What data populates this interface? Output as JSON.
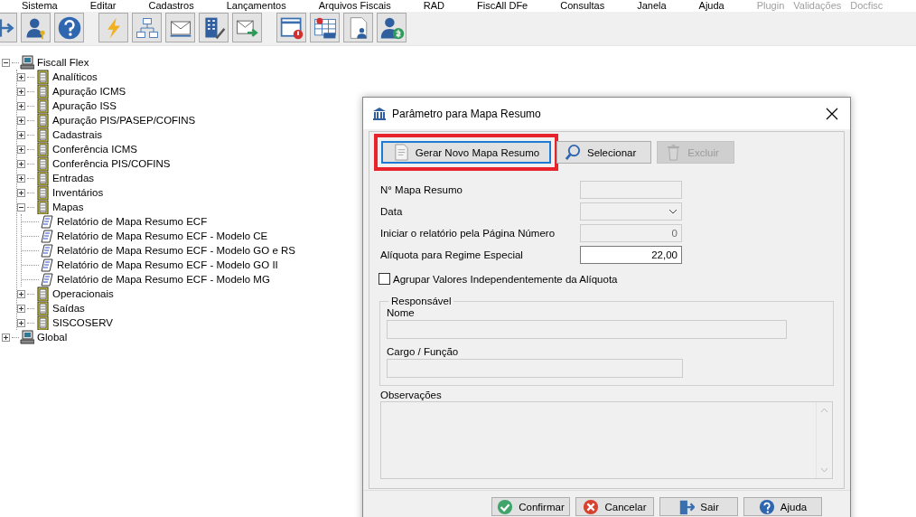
{
  "menu": [
    {
      "label": "Sistema",
      "disabled": false
    },
    {
      "label": "Editar",
      "disabled": false
    },
    {
      "label": "Cadastros",
      "disabled": false
    },
    {
      "label": "Lançamentos",
      "disabled": false
    },
    {
      "label": "Arquivos Fiscais",
      "disabled": false
    },
    {
      "label": "RAD",
      "disabled": false
    },
    {
      "label": "FiscAll DFe",
      "disabled": false
    },
    {
      "label": "Consultas",
      "disabled": false
    },
    {
      "label": "Janela",
      "disabled": false
    },
    {
      "label": "Ajuda",
      "disabled": false
    },
    {
      "label": "Plugin",
      "disabled": true
    },
    {
      "label": "Validações",
      "disabled": true
    },
    {
      "label": "Docfisc",
      "disabled": true
    }
  ],
  "tree": [
    {
      "label": "Fiscall Flex",
      "kind": "root",
      "expanded": true,
      "children": [
        {
          "label": "Analíticos",
          "kind": "folder",
          "expanded": false
        },
        {
          "label": "Apuração ICMS",
          "kind": "folder",
          "expanded": false
        },
        {
          "label": "Apuração ISS",
          "kind": "folder",
          "expanded": false
        },
        {
          "label": "Apuração PIS/PASEP/COFINS",
          "kind": "folder",
          "expanded": false
        },
        {
          "label": "Cadastrais",
          "kind": "folder",
          "expanded": false
        },
        {
          "label": "Conferência ICMS",
          "kind": "folder",
          "expanded": false
        },
        {
          "label": "Conferência PIS/COFINS",
          "kind": "folder",
          "expanded": false
        },
        {
          "label": "Entradas",
          "kind": "folder",
          "expanded": false
        },
        {
          "label": "Inventários",
          "kind": "folder",
          "expanded": false
        },
        {
          "label": "Mapas",
          "kind": "folder",
          "expanded": true,
          "children": [
            {
              "label": "Relatório de Mapa Resumo ECF",
              "kind": "report"
            },
            {
              "label": "Relatório de Mapa Resumo ECF - Modelo CE",
              "kind": "report"
            },
            {
              "label": "Relatório de Mapa Resumo ECF - Modelo GO e RS",
              "kind": "report"
            },
            {
              "label": "Relatório de Mapa Resumo ECF - Modelo GO II",
              "kind": "report"
            },
            {
              "label": "Relatório de Mapa Resumo ECF - Modelo MG",
              "kind": "report"
            }
          ]
        },
        {
          "label": "Operacionais",
          "kind": "folder",
          "expanded": false
        },
        {
          "label": "Saídas",
          "kind": "folder",
          "expanded": false
        },
        {
          "label": "SISCOSERV",
          "kind": "folder",
          "expanded": false
        }
      ]
    },
    {
      "label": "Global",
      "kind": "root",
      "expanded": false
    }
  ],
  "dialog": {
    "title": "Parâmetro para Mapa Resumo",
    "actions": [
      {
        "label": "Gerar Novo Mapa Resumo",
        "disabled": false,
        "highlighted": true
      },
      {
        "label": "Selecionar",
        "disabled": false,
        "highlighted": false
      },
      {
        "label": "Excluir",
        "disabled": true,
        "highlighted": false
      }
    ],
    "fields": [
      {
        "label": "N° Mapa Resumo",
        "kind": "text",
        "disabled": true
      },
      {
        "label": "Data",
        "kind": "select",
        "disabled": true
      },
      {
        "label": "Iniciar o relatório pela Página Número",
        "kind": "text",
        "value": "0",
        "disabled": true
      },
      {
        "label": "Alíquota para Regime Especial",
        "kind": "text",
        "value": "22,00",
        "disabled": false
      }
    ],
    "checkbox": {
      "label": "Agrupar Valores Independentemente da Alíquota",
      "checked": false
    },
    "group": {
      "legend": "Responsável",
      "fields": [
        {
          "label": "Nome",
          "disabled": true
        },
        {
          "label": "Cargo / Função",
          "disabled": true
        }
      ]
    },
    "notes": {
      "label": "Observações",
      "disabled": true
    },
    "buttons": [
      {
        "label": "Confirmar"
      },
      {
        "label": "Cancelar"
      },
      {
        "label": "Sair"
      },
      {
        "label": "Ajuda"
      }
    ]
  }
}
